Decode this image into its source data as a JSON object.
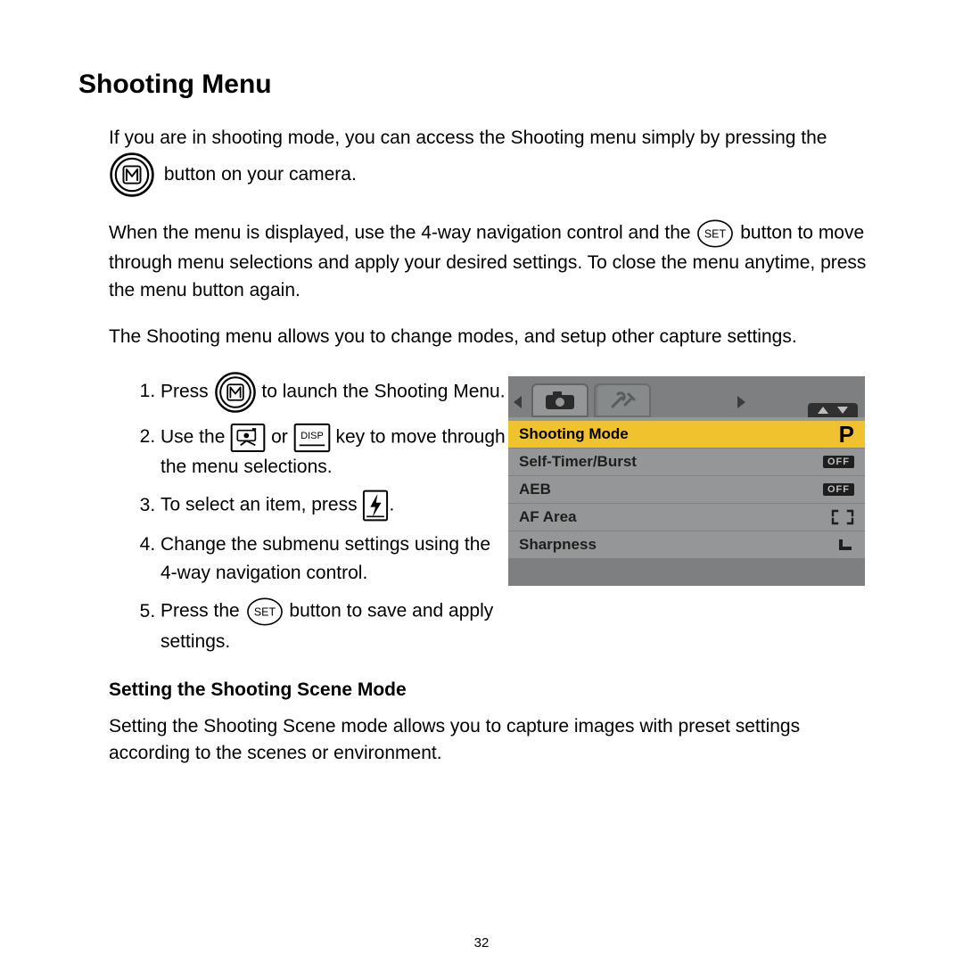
{
  "title": "Shooting Menu",
  "intro1a": "If you are in shooting mode, you can access the Shooting menu simply by pressing the",
  "intro1b": "button on your camera.",
  "intro2a": "When the menu is displayed, use the 4-way navigation control and the",
  "intro2b": "button to move through menu selections and apply your desired settings. To close the menu anytime, press the menu button again.",
  "intro3": "The Shooting menu allows you to change modes, and setup other capture settings.",
  "steps": {
    "s1a": "Press",
    "s1b": "to launch the Shooting Menu.",
    "s2a": "Use the",
    "s2or": "or",
    "s2b": "key to move through the menu selections.",
    "s3a": "To select an item, press",
    "s3b": ".",
    "s4": "Change the submenu settings using the 4-way navigation control.",
    "s5a": "Press the",
    "s5b": "button to save and apply settings."
  },
  "subhead": "Setting the Shooting Scene Mode",
  "subtext": "Setting the Shooting Scene mode allows you to capture images with preset settings according to the scenes or environment.",
  "page_number": "32",
  "lcd": {
    "rows": [
      {
        "label": "Shooting Mode",
        "value": "P",
        "kind": "P",
        "selected": true
      },
      {
        "label": "Self-Timer/Burst",
        "value": "OFF",
        "kind": "off"
      },
      {
        "label": "AEB",
        "value": "OFF",
        "kind": "off"
      },
      {
        "label": "AF Area",
        "value": "",
        "kind": "af"
      },
      {
        "label": "Sharpness",
        "value": "",
        "kind": "sharp"
      }
    ]
  },
  "icons": {
    "menu": "menu-button",
    "set": "set-button",
    "review": "review-button",
    "disp": "disp-button",
    "flash": "flash-button"
  }
}
